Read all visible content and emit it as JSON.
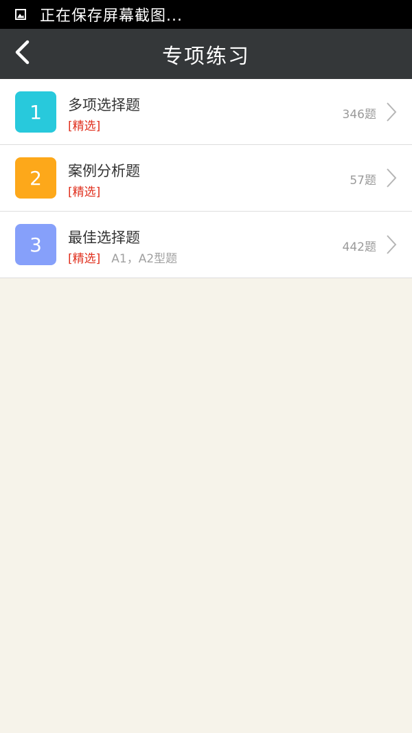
{
  "status_bar": {
    "icon": "image-icon",
    "text": "正在保存屏幕截图..."
  },
  "header": {
    "back_icon": "chevron-left-icon",
    "title": "专项练习"
  },
  "items": [
    {
      "index": "1",
      "title": "多项选择题",
      "tag": "[精选]",
      "desc": "",
      "count": "346题",
      "color": "#28c9dc"
    },
    {
      "index": "2",
      "title": "案例分析题",
      "tag": "[精选]",
      "desc": "",
      "count": "57题",
      "color": "#fda81a"
    },
    {
      "index": "3",
      "title": "最佳选择题",
      "tag": "[精选]",
      "desc": "A1，A2型题",
      "count": "442题",
      "color": "#86a0fa"
    }
  ],
  "colors": {
    "nav_bg": "#343739",
    "page_bg": "#f6f3ea",
    "tag_red": "#e0301e"
  }
}
